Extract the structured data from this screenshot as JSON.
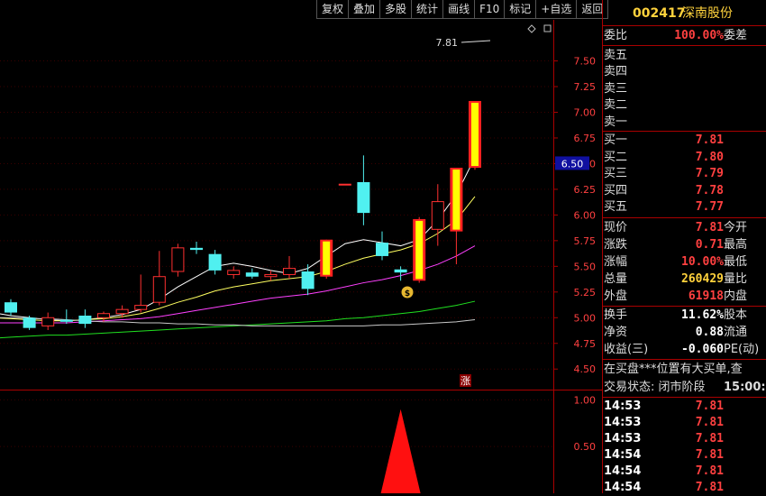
{
  "toolbar": {
    "buttons": [
      "复权",
      "叠加",
      "多股",
      "统计",
      "画线",
      "F10",
      "标记",
      "+自选",
      "返回"
    ]
  },
  "stock": {
    "code": "002417",
    "name": "深南股份"
  },
  "quote": {
    "weibi_label": "委比",
    "weibi_value": "100.00%",
    "weicha_label": "委差",
    "sell": [
      {
        "label": "卖五",
        "price": ""
      },
      {
        "label": "卖四",
        "price": ""
      },
      {
        "label": "卖三",
        "price": ""
      },
      {
        "label": "卖二",
        "price": ""
      },
      {
        "label": "卖一",
        "price": ""
      }
    ],
    "buy": [
      {
        "label": "买一",
        "price": "7.81"
      },
      {
        "label": "买二",
        "price": "7.80"
      },
      {
        "label": "买三",
        "price": "7.79"
      },
      {
        "label": "买四",
        "price": "7.78"
      },
      {
        "label": "买五",
        "price": "7.77"
      }
    ],
    "stats": [
      {
        "label": "现价",
        "value": "7.81",
        "tail": "今开",
        "color": "red"
      },
      {
        "label": "涨跌",
        "value": "0.71",
        "tail": "最高",
        "color": "red"
      },
      {
        "label": "涨幅",
        "value": "10.00%",
        "tail": "最低",
        "color": "red"
      },
      {
        "label": "总量",
        "value": "260429",
        "tail": "量比",
        "color": "yel"
      },
      {
        "label": "外盘",
        "value": "61918",
        "tail": "内盘",
        "color": "red"
      }
    ],
    "stats2": [
      {
        "label": "换手",
        "value": "11.62%",
        "tail": "股本",
        "color": "wht"
      },
      {
        "label": "净资",
        "value": "0.88",
        "tail": "流通",
        "color": "wht"
      },
      {
        "label": "收益(三)",
        "value": "-0.060",
        "tail": "PE(动)",
        "color": "wht"
      }
    ],
    "notice": "在买盘***位置有大买单,查",
    "trade_status": "交易状态: 闭市阶段",
    "trade_time": "15:00:",
    "ticks": [
      {
        "time": "14:53",
        "price": "7.81"
      },
      {
        "time": "14:53",
        "price": "7.81"
      },
      {
        "time": "14:53",
        "price": "7.81"
      },
      {
        "time": "14:54",
        "price": "7.81"
      },
      {
        "time": "14:54",
        "price": "7.81"
      },
      {
        "time": "14:54",
        "price": "7.81"
      }
    ]
  },
  "chart_data": {
    "type": "candlestick",
    "price_axis": {
      "ticks": [
        4.5,
        4.75,
        5.0,
        5.25,
        5.5,
        5.75,
        6.0,
        6.25,
        6.5,
        6.75,
        7.0,
        7.25,
        7.5
      ],
      "ylim": [
        4.3,
        7.9
      ]
    },
    "cursor_price": "6.50",
    "high_label": "7.81",
    "limit_up_badge": "涨",
    "candles": [
      {
        "o": 5.15,
        "h": 5.18,
        "l": 5.02,
        "c": 5.05
      },
      {
        "o": 5.0,
        "h": 5.02,
        "l": 4.88,
        "c": 4.9
      },
      {
        "o": 4.92,
        "h": 5.05,
        "l": 4.88,
        "c": 5.0
      },
      {
        "o": 4.98,
        "h": 5.08,
        "l": 4.94,
        "c": 4.96
      },
      {
        "o": 5.02,
        "h": 5.08,
        "l": 4.9,
        "c": 4.94
      },
      {
        "o": 5.0,
        "h": 5.06,
        "l": 4.96,
        "c": 5.04
      },
      {
        "o": 5.04,
        "h": 5.12,
        "l": 5.0,
        "c": 5.08
      },
      {
        "o": 5.08,
        "h": 5.42,
        "l": 5.05,
        "c": 5.12
      },
      {
        "o": 5.15,
        "h": 5.65,
        "l": 5.12,
        "c": 5.4
      },
      {
        "o": 5.45,
        "h": 5.72,
        "l": 5.4,
        "c": 5.68
      },
      {
        "o": 5.68,
        "h": 5.74,
        "l": 5.62,
        "c": 5.66
      },
      {
        "o": 5.62,
        "h": 5.66,
        "l": 5.42,
        "c": 5.46
      },
      {
        "o": 5.42,
        "h": 5.5,
        "l": 5.38,
        "c": 5.46
      },
      {
        "o": 5.44,
        "h": 5.48,
        "l": 5.38,
        "c": 5.4
      },
      {
        "o": 5.4,
        "h": 5.46,
        "l": 5.36,
        "c": 5.42
      },
      {
        "o": 5.42,
        "h": 5.6,
        "l": 5.38,
        "c": 5.48
      },
      {
        "o": 5.45,
        "h": 5.52,
        "l": 5.22,
        "c": 5.28
      },
      {
        "o": 5.4,
        "h": 5.76,
        "l": 5.38,
        "c": 5.76
      },
      {
        "o": 6.3,
        "h": 6.3,
        "l": 6.3,
        "c": 6.3
      },
      {
        "o": 6.32,
        "h": 6.58,
        "l": 5.9,
        "c": 6.02
      },
      {
        "o": 5.73,
        "h": 5.84,
        "l": 5.56,
        "c": 5.6
      },
      {
        "o": 5.47,
        "h": 5.5,
        "l": 5.36,
        "c": 5.44
      },
      {
        "o": 5.36,
        "h": 5.98,
        "l": 5.34,
        "c": 5.96
      },
      {
        "o": 5.86,
        "h": 6.3,
        "l": 5.7,
        "c": 6.13
      },
      {
        "o": 5.84,
        "h": 6.46,
        "l": 5.52,
        "c": 6.46
      },
      {
        "o": 6.46,
        "h": 7.11,
        "l": 6.44,
        "c": 7.11
      }
    ],
    "ma": [
      {
        "name": "MA5",
        "color": "#ffffff",
        "values": [
          5.05,
          5.02,
          5.0,
          4.98,
          4.97,
          4.98,
          5.0,
          5.03,
          5.08,
          5.18,
          5.3,
          5.4,
          5.5,
          5.53,
          5.5,
          5.46,
          5.43,
          5.48,
          5.6,
          5.72,
          5.76,
          5.73,
          5.7,
          5.76,
          5.95,
          6.2,
          6.56
        ]
      },
      {
        "name": "MA10",
        "color": "#ffff60",
        "values": [
          5.0,
          4.99,
          4.98,
          4.97,
          4.97,
          4.98,
          4.99,
          5.01,
          5.04,
          5.09,
          5.15,
          5.2,
          5.26,
          5.3,
          5.33,
          5.36,
          5.38,
          5.4,
          5.45,
          5.52,
          5.58,
          5.62,
          5.66,
          5.72,
          5.82,
          5.95,
          6.18
        ]
      },
      {
        "name": "MA20",
        "color": "#ff40ff",
        "values": [
          4.95,
          4.95,
          4.95,
          4.95,
          4.95,
          4.96,
          4.97,
          4.98,
          4.99,
          5.01,
          5.04,
          5.07,
          5.1,
          5.13,
          5.16,
          5.19,
          5.21,
          5.23,
          5.26,
          5.3,
          5.34,
          5.37,
          5.41,
          5.46,
          5.52,
          5.6,
          5.7
        ]
      },
      {
        "name": "MA60",
        "color": "#20e020",
        "values": [
          4.8,
          4.81,
          4.82,
          4.83,
          4.83,
          4.84,
          4.85,
          4.86,
          4.87,
          4.88,
          4.89,
          4.9,
          4.91,
          4.92,
          4.93,
          4.94,
          4.95,
          4.96,
          4.97,
          4.99,
          5.0,
          5.02,
          5.04,
          5.06,
          5.09,
          5.12,
          5.16
        ]
      },
      {
        "name": "MA120",
        "color": "#c8c8c8",
        "values": [
          5.0,
          5.0,
          4.99,
          4.99,
          4.98,
          4.97,
          4.96,
          4.96,
          4.95,
          4.95,
          4.94,
          4.94,
          4.93,
          4.93,
          4.92,
          4.92,
          4.92,
          4.92,
          4.92,
          4.92,
          4.92,
          4.93,
          4.93,
          4.94,
          4.95,
          4.96,
          4.98
        ]
      }
    ],
    "indicator_axis": {
      "ticks": [
        1.0,
        0.5
      ],
      "ylim": [
        0,
        1.1
      ]
    },
    "indicator_peak": {
      "index": 21,
      "value": 0.9
    }
  }
}
